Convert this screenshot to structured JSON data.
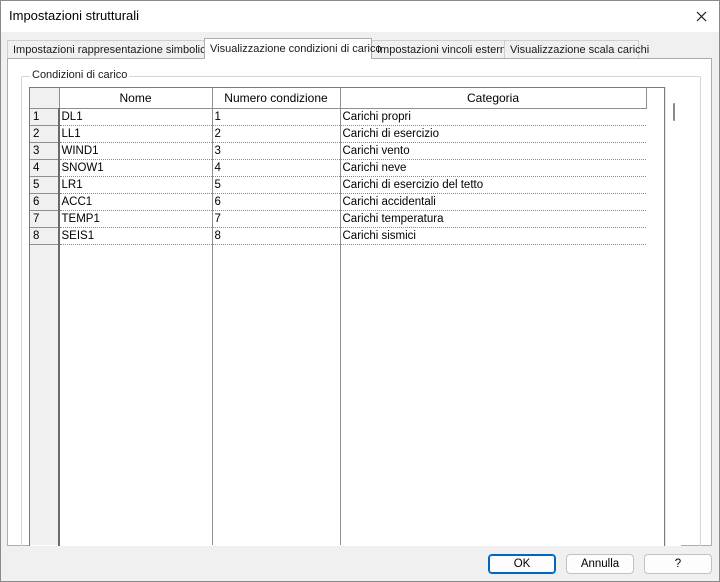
{
  "window": {
    "title": "Impostazioni strutturali"
  },
  "tabs": [
    {
      "label": "Impostazioni rappresentazione simbolica",
      "active": false
    },
    {
      "label": "Visualizzazione condizioni di carico",
      "active": true
    },
    {
      "label": "Impostazioni vincoli esterni",
      "active": false
    },
    {
      "label": "Visualizzazione scala carichi",
      "active": false
    }
  ],
  "group": {
    "label": "Condizioni di carico"
  },
  "table": {
    "columns": [
      "Nome",
      "Numero condizione",
      "Categoria"
    ],
    "rows": [
      {
        "num": "1",
        "nome": "DL1",
        "numero": "1",
        "categoria": "Carichi propri"
      },
      {
        "num": "2",
        "nome": "LL1",
        "numero": "2",
        "categoria": "Carichi di esercizio"
      },
      {
        "num": "3",
        "nome": "WIND1",
        "numero": "3",
        "categoria": "Carichi vento"
      },
      {
        "num": "4",
        "nome": "SNOW1",
        "numero": "4",
        "categoria": "Carichi neve"
      },
      {
        "num": "5",
        "nome": "LR1",
        "numero": "5",
        "categoria": "Carichi di esercizio del tetto"
      },
      {
        "num": "6",
        "nome": "ACC1",
        "numero": "6",
        "categoria": "Carichi accidentali"
      },
      {
        "num": "7",
        "nome": "TEMP1",
        "numero": "7",
        "categoria": "Carichi temperatura"
      },
      {
        "num": "8",
        "nome": "SEIS1",
        "numero": "8",
        "categoria": "Carichi sismici"
      }
    ]
  },
  "buttons": {
    "ok": "OK",
    "cancel": "Annulla",
    "help": "?"
  },
  "icons": {
    "close": "close-icon"
  },
  "colors": {
    "primary_border": "#0067c0"
  }
}
